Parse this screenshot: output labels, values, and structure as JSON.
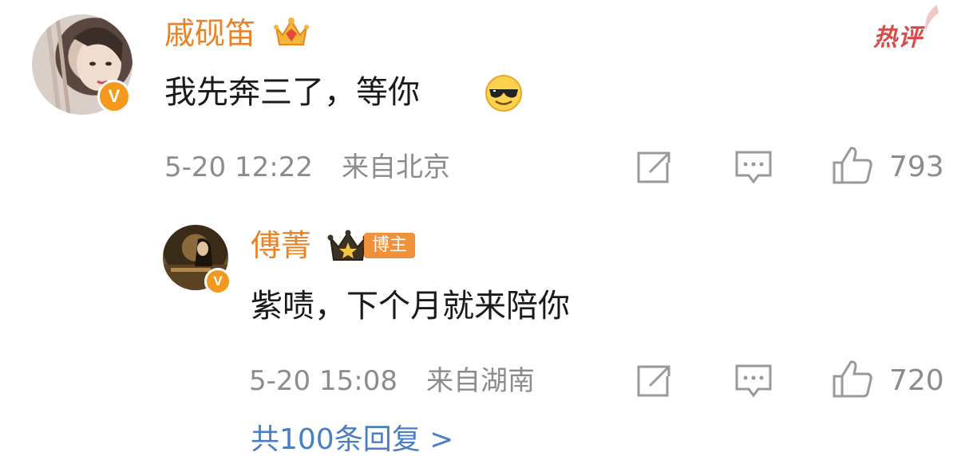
{
  "comment": {
    "username": "戚砚笛",
    "text": "我先奔三了，等你",
    "emoji_icon": "sunglasses-emoji-icon",
    "timestamp": "5-20 12:22",
    "location": "来自北京",
    "like_count": "793",
    "hot_badge": "热评",
    "verified_badge": "V",
    "accent_color": "#e8832a"
  },
  "reply": {
    "username": "傅菁",
    "role_tag": "博主",
    "text": "紫啧，下个月就来陪你",
    "timestamp": "5-20 15:08",
    "location": "来自湖南",
    "like_count": "720",
    "verified_badge": "V"
  },
  "footer": {
    "more_replies": "共100条回复 >"
  }
}
